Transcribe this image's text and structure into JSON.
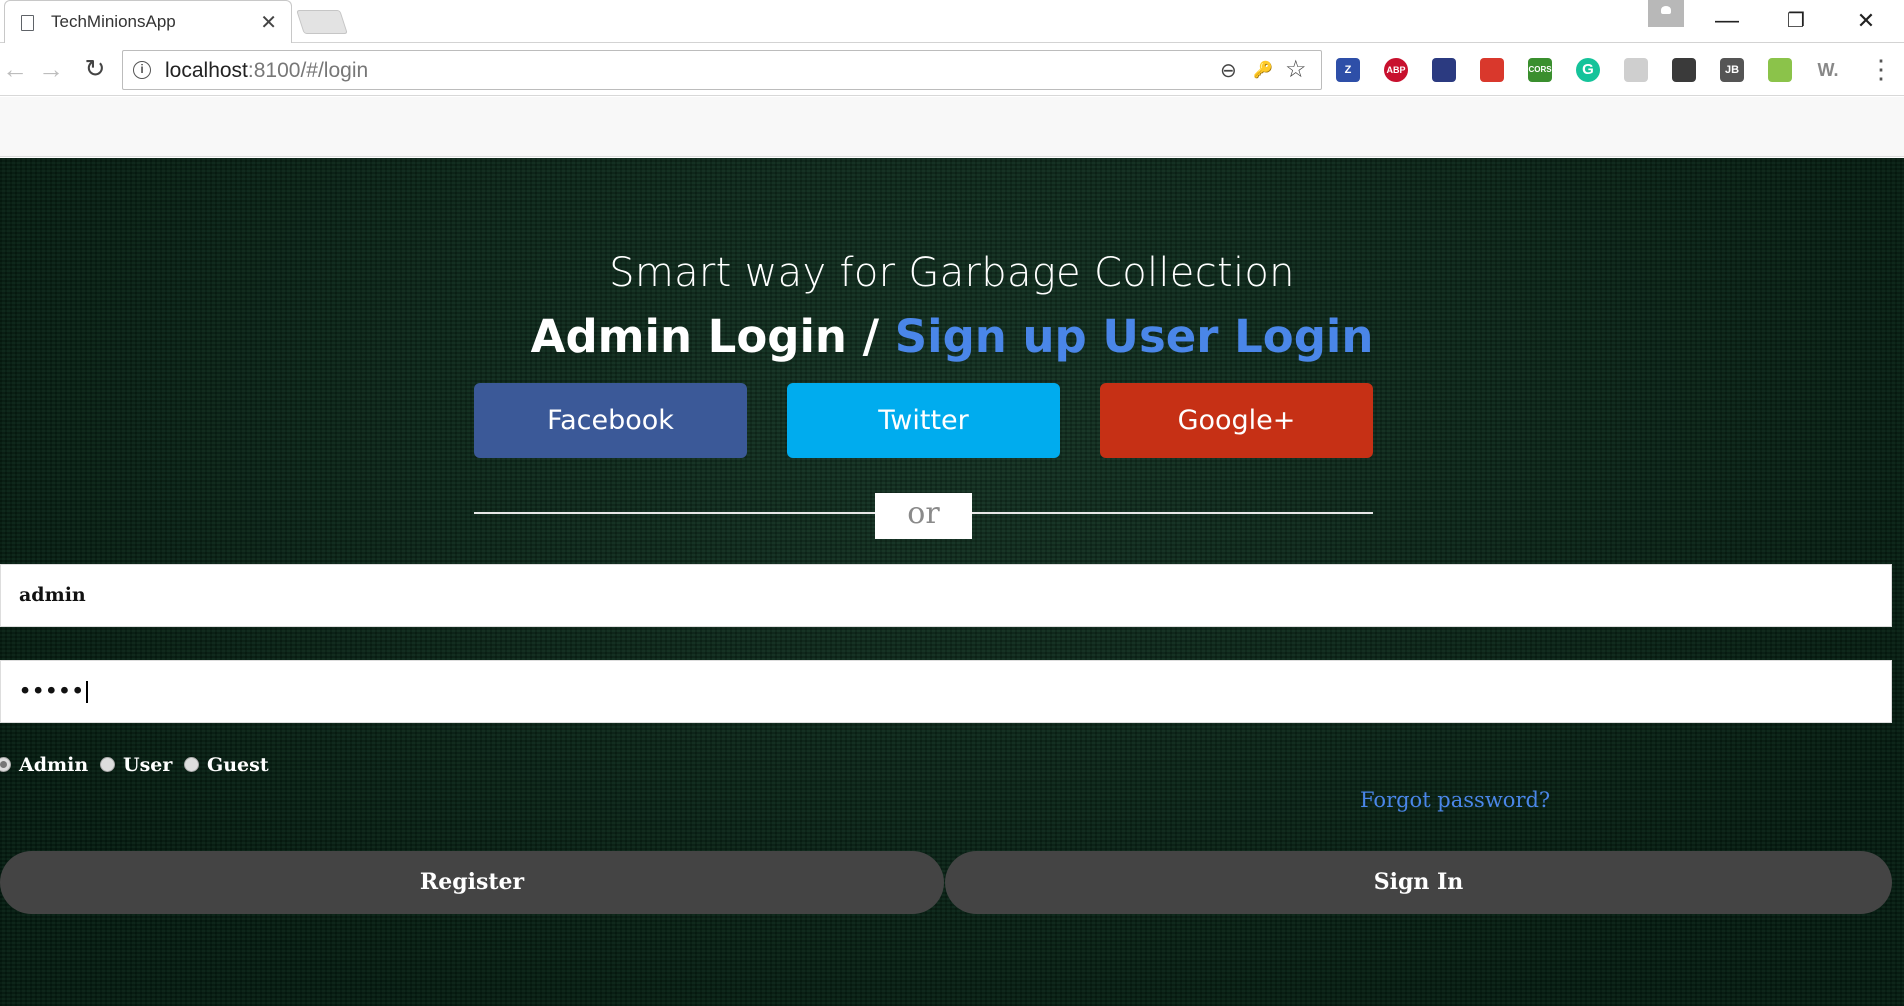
{
  "browser": {
    "tab_title": "TechMinionsApp",
    "tab_close": "✕",
    "url_host": "localhost",
    "url_rest": ":8100/#/login",
    "window_minimize": "—",
    "window_restore": "❐",
    "window_close": "✕",
    "back": "←",
    "forward": "→",
    "reload": "↻",
    "zoom_icon": "⊖",
    "key_icon": "🔑",
    "star_icon": "☆",
    "menu": "⋮",
    "extensions": [
      {
        "name": "zotero-extension-icon",
        "label": "Z",
        "color": "#2e4fa8"
      },
      {
        "name": "adblock-plus-icon",
        "label": "ABP",
        "color": "#c8102e"
      },
      {
        "name": "extension-icon-3",
        "label": "",
        "color": "#2b3a80"
      },
      {
        "name": "extension-icon-4",
        "label": "",
        "color": "#d9382c"
      },
      {
        "name": "cors-extension-icon",
        "label": "CORS",
        "color": "#3a8f2e"
      },
      {
        "name": "grammarly-icon",
        "label": "G",
        "color": "#15c39a"
      },
      {
        "name": "extension-icon-7",
        "label": "",
        "color": "#cfcfcf"
      },
      {
        "name": "shield-extension-icon",
        "label": "",
        "color": "#3a3a3a"
      },
      {
        "name": "jb-extension-icon",
        "label": "JB",
        "color": "#555555"
      },
      {
        "name": "extension-icon-10",
        "label": "",
        "color": "#8bc34a"
      },
      {
        "name": "w-extension-icon",
        "label": "W.",
        "color": "#ffffff"
      }
    ]
  },
  "page": {
    "tagline": "Smart way for Garbage Collection",
    "headline_admin": "Admin Login",
    "headline_slash": "/",
    "headline_signup": "Sign up User Login",
    "social": {
      "facebook": "Facebook",
      "twitter": "Twitter",
      "google": "Google+"
    },
    "or_label": "or",
    "username_value": "admin",
    "password_value": "•••••",
    "roles": [
      {
        "label": "Admin",
        "checked": true
      },
      {
        "label": "User",
        "checked": false
      },
      {
        "label": "Guest",
        "checked": false
      }
    ],
    "forgot_password": "Forgot password?",
    "register_label": "Register",
    "signin_label": "Sign In"
  },
  "colors": {
    "facebook": "#3b5998",
    "twitter": "#00acee",
    "google": "#c63015",
    "link_blue": "#4a86e8",
    "background": "#082a19",
    "action_button": "#444444"
  }
}
